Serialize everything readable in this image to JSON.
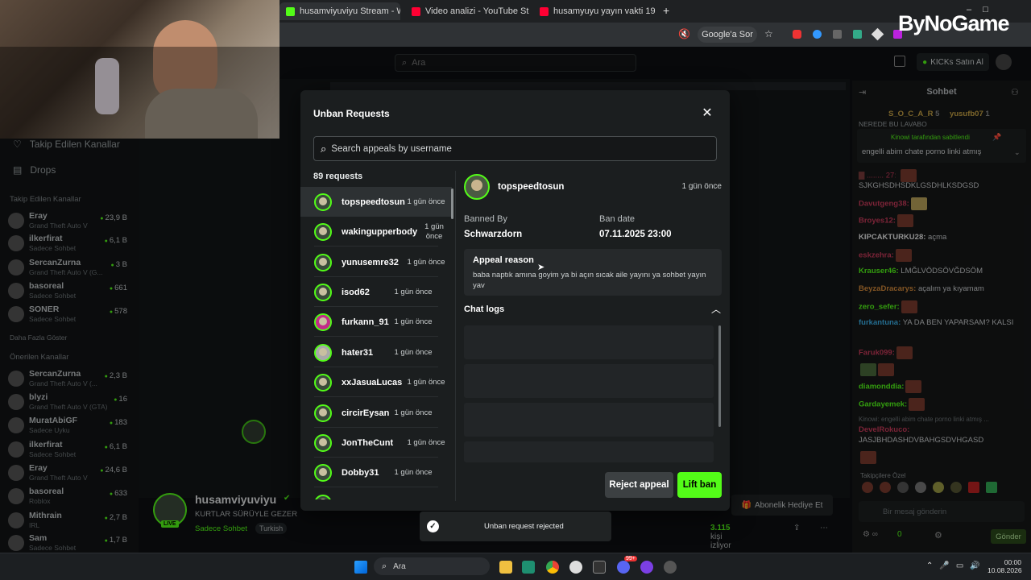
{
  "browser": {
    "tabs": [
      {
        "title": "husamviyuviyu Stream - Wa",
        "icon_color": "#53fc18"
      },
      {
        "title": "Video analizi - YouTube Studio",
        "icon_color": "#ff0033"
      },
      {
        "title": "husamyuyu yayın vakti 19 - You",
        "icon_color": "#ff0033"
      }
    ],
    "new_tab": "+",
    "google_sor": "Google'a Sor"
  },
  "kick": {
    "search_placeholder": "Ara",
    "buy_kicks": "KICKs Satın Al",
    "nav": {
      "followed": "Takip Edilen Kanallar",
      "drops": "Drops"
    },
    "followed_header": "Takip Edilen Kanallar",
    "followed": [
      {
        "name": "Eray",
        "game": "Grand Theft Auto V",
        "viewers": "23,9 B"
      },
      {
        "name": "ilkerfirat",
        "game": "Sadece Sohbet",
        "viewers": "6,1 B"
      },
      {
        "name": "SercanZurna",
        "game": "Grand Theft Auto V (G...",
        "viewers": "3 B"
      },
      {
        "name": "basoreal",
        "game": "Sadece Sohbet",
        "viewers": "661"
      },
      {
        "name": "SONER",
        "game": "Sadece Sohbet",
        "viewers": "578"
      }
    ],
    "show_more": "Daha Fazla Göster",
    "recommended_header": "Önerilen Kanallar",
    "recommended": [
      {
        "name": "SercanZurna",
        "game": "Grand Theft Auto V (...",
        "viewers": "2,3 B"
      },
      {
        "name": "blyzi",
        "game": "Grand Theft Auto V (GTA)",
        "viewers": "16"
      },
      {
        "name": "MuratAbiGF",
        "game": "Sadece Uyku",
        "viewers": "183"
      },
      {
        "name": "ilkerfirat",
        "game": "Sadece Sohbet",
        "viewers": "6,1 B"
      },
      {
        "name": "Eray",
        "game": "Grand Theft Auto V",
        "viewers": "24,6 B"
      },
      {
        "name": "basoreal",
        "game": "Roblox",
        "viewers": "633"
      },
      {
        "name": "Mithrain",
        "game": "IRL",
        "viewers": "2,7 B"
      },
      {
        "name": "Sam",
        "game": "Sadece Sohbet",
        "viewers": "1,7 B"
      }
    ],
    "stream": {
      "channel": "husamviyuviyu",
      "title": "KURTLAR SÜRÜYLE GEZER",
      "category": "Sadece Sohbet",
      "language": "Turkish",
      "live": "LIVE",
      "viewers": "3.115",
      "viewers_suffix": "kişi izliyor",
      "gift_sub": "Abonelik Hediye Et"
    },
    "chat": {
      "title": "Sohbet",
      "top_gifters": [
        {
          "name": "S_O_C_A_R",
          "count": "5"
        },
        {
          "name": "yusufb07",
          "count": "1"
        }
      ],
      "pinned_by": "Kinowi tarafından sabitlendi",
      "pinned_text": "engelli abim chate porno linki atmış",
      "top_msg": "NEREDE BU LAVABO",
      "messages": [
        {
          "user": "",
          "text": "SJKGHSDHSDKLGSDHLKSDGSD"
        },
        {
          "user": "Davutgeng38:",
          "text": ""
        },
        {
          "user": "Broyes12:",
          "text": ""
        },
        {
          "user": "KIPCAKTURKU28:",
          "text": "açma"
        },
        {
          "user": "eskzehra:",
          "text": ""
        },
        {
          "user": "Krauser46:",
          "text": "LMĞLVÖDSÖVĞDSÖM"
        },
        {
          "user": "BeyzaDracarys:",
          "text": "açalım ya kıyamam"
        },
        {
          "user": "zero_sefer:",
          "text": ""
        },
        {
          "user": "furkantuna:",
          "text": "YA DA BEN YAPARSAM? KALSI"
        },
        {
          "user": "Faruk099:",
          "text": ""
        },
        {
          "user": "",
          "text": ""
        },
        {
          "user": "diamonddia:",
          "text": ""
        },
        {
          "user": "Gardayemek:",
          "text": ""
        },
        {
          "user": "DevelRokuco:",
          "text": "JASJBHDASHDVBAHGSDVHGASD"
        },
        {
          "user": "",
          "text": ""
        }
      ],
      "reply_preview": "Kinowi: engelli abim chate porno linki atmış ...",
      "emote_label": "Takipçilere Özel",
      "input_placeholder": "Bir mesaj gönderin",
      "points": "0",
      "send": "Gönder"
    }
  },
  "modal": {
    "title": "Unban Requests",
    "search_placeholder": "Search appeals by username",
    "count": "89 requests",
    "requests": [
      {
        "username": "topspeedtosun",
        "time": "1 gün önce",
        "selected": true
      },
      {
        "username": "wakingupperbody",
        "time": "1 gün önce"
      },
      {
        "username": "yunusemre32",
        "time": "1 gün önce"
      },
      {
        "username": "isod62",
        "time": "1 gün önce"
      },
      {
        "username": "furkann_91",
        "time": "1 gün önce"
      },
      {
        "username": "hater31",
        "time": "1 gün önce"
      },
      {
        "username": "xxJasuaLucas",
        "time": "1 gün önce"
      },
      {
        "username": "circirEysan",
        "time": "1 gün önce"
      },
      {
        "username": "JonTheCunt",
        "time": "1 gün önce"
      },
      {
        "username": "Dobby31",
        "time": "1 gün önce"
      }
    ],
    "detail": {
      "username": "topspeedtosun",
      "time": "1 gün önce",
      "banned_by_label": "Banned By",
      "banned_by": "Schwarzdorn",
      "ban_date_label": "Ban date",
      "ban_date": "07.11.2025 23:00",
      "appeal_reason_label": "Appeal reason",
      "appeal_reason": "baba naptık amına goyim ya bi açın sıcak aile yayını ya sohbet yayın yav",
      "chat_logs_label": "Chat logs"
    },
    "reject_button": "Reject appeal",
    "lift_button": "Lift ban"
  },
  "toast": {
    "text": "Unban request rejected"
  },
  "taskbar": {
    "search": "Ara",
    "time": "00:00",
    "date": "10.08.2026",
    "discord_badge": "99+"
  },
  "watermark": "ByNoGame",
  "colors": {
    "kick_green": "#53fc18",
    "modal_bg": "#1b1e1f",
    "page_bg": "#0e1012"
  }
}
